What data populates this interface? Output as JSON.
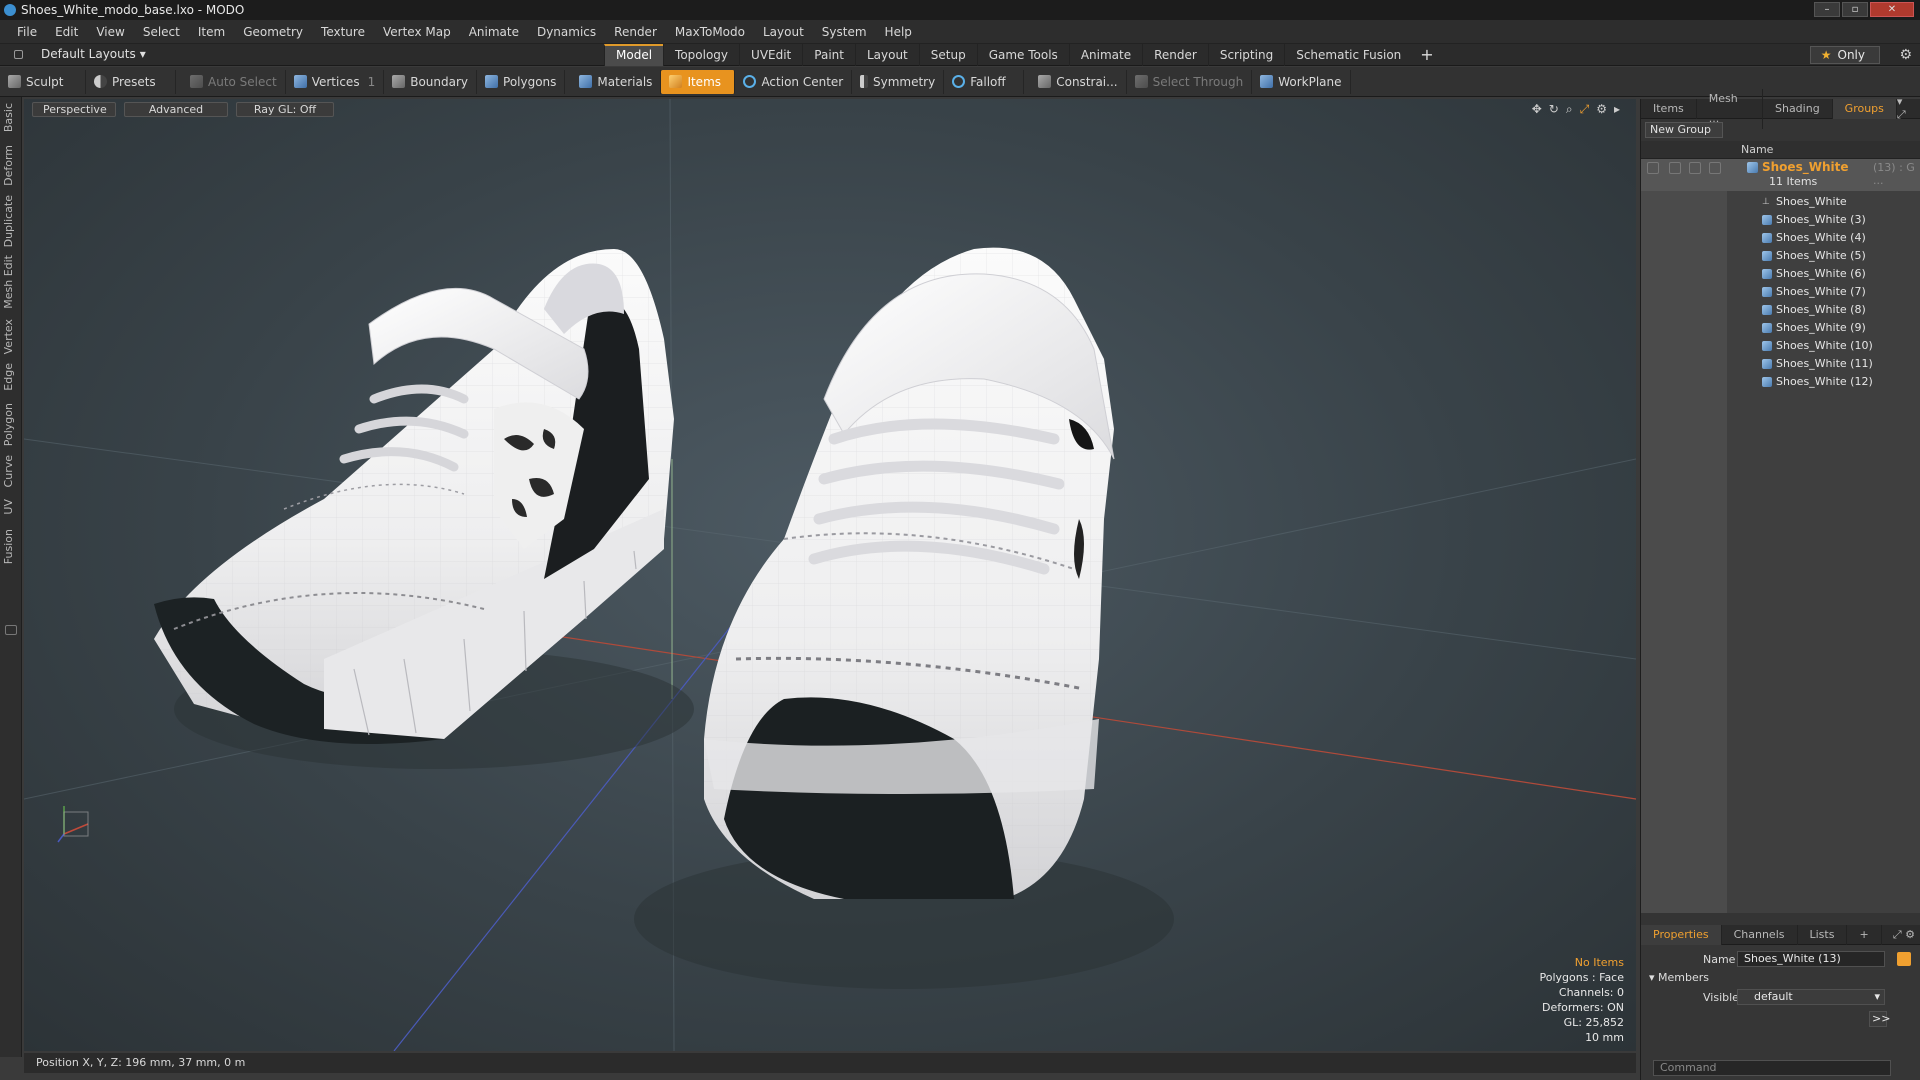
{
  "window": {
    "title": "Shoes_White_modo_base.lxo - MODO"
  },
  "menu": [
    "File",
    "Edit",
    "View",
    "Select",
    "Item",
    "Geometry",
    "Texture",
    "Vertex Map",
    "Animate",
    "Dynamics",
    "Render",
    "MaxToModo",
    "Layout",
    "System",
    "Help"
  ],
  "layout_dropdown": "Default Layouts",
  "tabs": [
    "Model",
    "Topology",
    "UVEdit",
    "Paint",
    "Layout",
    "Setup",
    "Game Tools",
    "Animate",
    "Render",
    "Scripting",
    "Schematic Fusion"
  ],
  "active_tab": "Model",
  "only_button": "Only",
  "toolbar": {
    "sculpt": "Sculpt",
    "presets": "Presets",
    "auto_select": "Auto Select",
    "vertices": "Vertices",
    "vertices_count": "1",
    "boundary": "Boundary",
    "polygons": "Polygons",
    "materials": "Materials",
    "items": "Items",
    "action_center": "Action Center",
    "symmetry": "Symmetry",
    "falloff": "Falloff",
    "constraints": "Constrai...",
    "select_through": "Select Through",
    "workplane": "WorkPlane"
  },
  "left_tabs": [
    "Basic",
    "Deform",
    "Duplicate",
    "Mesh Edit",
    "Vertex",
    "Edge",
    "Polygon",
    "Curve",
    "UV",
    "Fusion"
  ],
  "viewport": {
    "view": "Perspective",
    "mode": "Advanced",
    "raygl": "Ray GL: Off",
    "stats": {
      "no_items": "No Items",
      "polygons": "Polygons : Face",
      "channels": "Channels: 0",
      "deformers": "Deformers: ON",
      "gl": "GL: 25,852",
      "unit": "10 mm"
    }
  },
  "status": {
    "position": "Position X, Y, Z:  196 mm, 37 mm, 0 m"
  },
  "right_panel": {
    "tabs": [
      "Items",
      "Mesh ...",
      "Shading",
      "Groups"
    ],
    "active_tab": "Groups",
    "new_group": "New Group",
    "name_header": "Name",
    "group": {
      "name": "Shoes_White",
      "count": "(13) : G ...",
      "sub": "11 Items"
    },
    "items": [
      "Shoes_White",
      "Shoes_White (3)",
      "Shoes_White (4)",
      "Shoes_White (5)",
      "Shoes_White (6)",
      "Shoes_White (7)",
      "Shoes_White (8)",
      "Shoes_White (9)",
      "Shoes_White (10)",
      "Shoes_White (11)",
      "Shoes_White (12)"
    ],
    "props_tabs": [
      "Properties",
      "Channels",
      "Lists",
      "+"
    ],
    "name_label": "Name",
    "name_value": "Shoes_White (13)",
    "members_label": "Members",
    "visible_label": "Visible",
    "visible_value": "default",
    "more_btn": ">>",
    "command_placeholder": "Command"
  },
  "colors": {
    "accent": "#f0a030",
    "active_tool": "#e8931f"
  }
}
